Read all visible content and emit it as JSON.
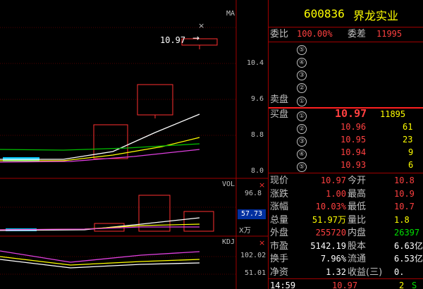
{
  "stock": {
    "code": "600836",
    "name": "界龙实业"
  },
  "panels": {
    "main_label": "MA",
    "vol_label": "VOL",
    "kdj_label": "KDJ",
    "price_ticks": [
      "10.4",
      "9.6",
      "8.8",
      "8.0"
    ],
    "vol_ticks": [
      "96.8"
    ],
    "vol_current": "57.73",
    "vol_unit": "X万",
    "kdj_ticks": [
      "102.02",
      "51.01"
    ],
    "price_tag": "10.97",
    "close_mark": "×",
    "arrow": "→"
  },
  "quote": {
    "weibi_label": "委比",
    "weibi_value": "100.00%",
    "weicha_label": "委差",
    "weicha_value": "11995",
    "sell_label": "卖盘",
    "sell_levels": [
      "⑤",
      "④",
      "③",
      "②",
      "①"
    ],
    "buy_label": "买盘",
    "buy_levels": [
      {
        "n": "①",
        "price": "10.97",
        "vol": "11895"
      },
      {
        "n": "②",
        "price": "10.96",
        "vol": "61"
      },
      {
        "n": "③",
        "price": "10.95",
        "vol": "23"
      },
      {
        "n": "④",
        "price": "10.94",
        "vol": "9"
      },
      {
        "n": "⑤",
        "price": "10.93",
        "vol": "6"
      }
    ],
    "stats": [
      {
        "l1": "现价",
        "v1": "10.97",
        "c1": "red",
        "l2": "今开",
        "v2": "10.8",
        "c2": "red"
      },
      {
        "l1": "涨跌",
        "v1": "1.00",
        "c1": "red",
        "l2": "最高",
        "v2": "10.9",
        "c2": "red"
      },
      {
        "l1": "涨幅",
        "v1": "10.03%",
        "c1": "red",
        "l2": "最低",
        "v2": "10.7",
        "c2": "red"
      },
      {
        "l1": "总量",
        "v1": "51.97万",
        "c1": "yel",
        "l2": "量比",
        "v2": "1.8",
        "c2": "yel"
      },
      {
        "l1": "外盘",
        "v1": "255720",
        "c1": "red",
        "l2": "内盘",
        "v2": "26397",
        "c2": "grn"
      },
      {
        "l1": "市盈",
        "v1": "5142.19",
        "c1": "wht",
        "l2": "股本",
        "v2": "6.63亿",
        "c2": "wht"
      },
      {
        "l1": "换手",
        "v1": "7.96%",
        "c1": "wht",
        "l2": "流通",
        "v2": "6.53亿",
        "c2": "wht"
      },
      {
        "l1": "净资",
        "v1": "1.32",
        "c1": "wht",
        "l2": "收益(三)",
        "v2": "0.",
        "c2": "wht"
      }
    ],
    "tick": {
      "time": "14:59",
      "price": "10.97",
      "vol": "2",
      "dir": "S"
    }
  },
  "colors": {
    "red": "#ff2020",
    "yellow": "#ffff00",
    "cyan": "#00c8ff",
    "magenta": "#e040e0",
    "green": "#00c000"
  }
}
